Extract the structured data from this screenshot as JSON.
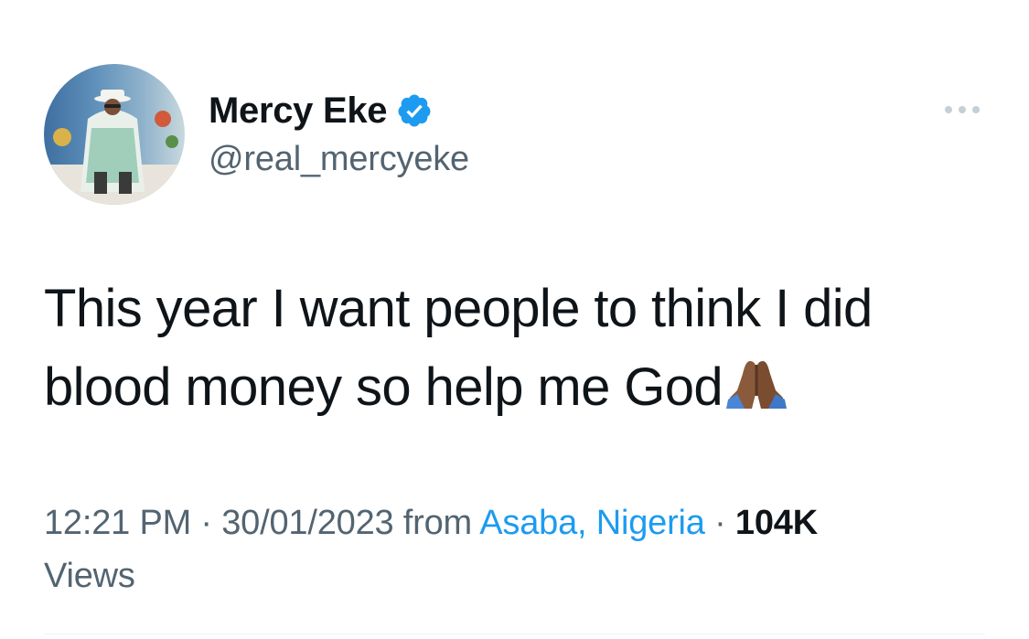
{
  "author": {
    "display_name": "Mercy Eke",
    "handle": "@real_mercyeke",
    "verified": true
  },
  "tweet": {
    "text": "This year I want people to think I did blood money so help me God",
    "emoji": "folded-hands-dark-skin"
  },
  "meta": {
    "time": "12:21 PM",
    "separator": "·",
    "date": "30/01/2023",
    "from_label": "from",
    "location": "Asaba, Nigeria",
    "views_count": "104K",
    "views_label": "Views"
  },
  "icons": {
    "verified": "verified-badge-icon",
    "more": "more-options-icon"
  },
  "colors": {
    "accent": "#1d9bf0",
    "secondary_text": "#536471",
    "primary_text": "#0f1419"
  }
}
